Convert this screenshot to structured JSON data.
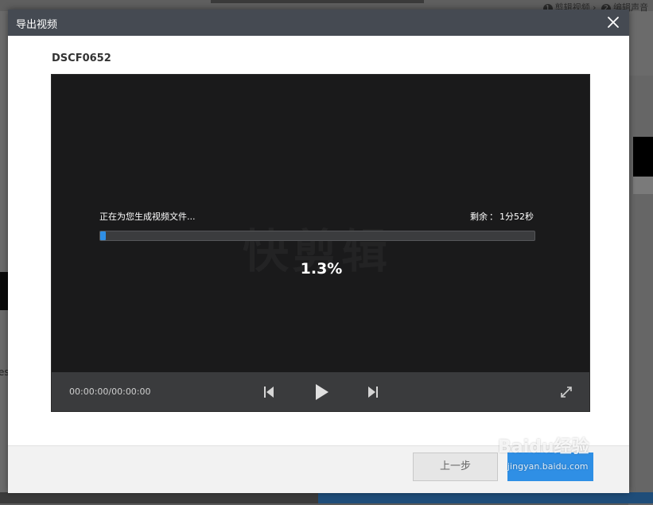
{
  "background": {
    "breadcrumb_step1_num": "1",
    "breadcrumb_step1": "剪辑视频",
    "breadcrumb_step2_num": "2",
    "breadcrumb_step2": "编辑声音",
    "left_edge_text": "es"
  },
  "dialog": {
    "title": "导出视频",
    "close_icon": "close-icon",
    "file_name": "DSCF0652",
    "player": {
      "watermark": "快剪辑",
      "status_text": "正在为您生成视频文件...",
      "remaining_label": "剩余",
      "remaining_separator": "：",
      "remaining_time": "1分52秒",
      "progress_percent_text": "1.3%",
      "progress_fraction": 0.013,
      "time_display": "00:00:00/00:00:00",
      "icons": {
        "prev": "skip-back-icon",
        "play": "play-icon",
        "next": "skip-forward-icon",
        "fullscreen": "fullscreen-icon"
      }
    },
    "footer": {
      "prev_step_label": "上一步"
    },
    "colors": {
      "header_bg": "#454a52",
      "progress_fill": "#2f8fe5",
      "primary_button": "#2f8fe5"
    }
  },
  "watermark_overlay": {
    "brand": "Baidu经验",
    "url": "jingyan.baidu.com"
  }
}
